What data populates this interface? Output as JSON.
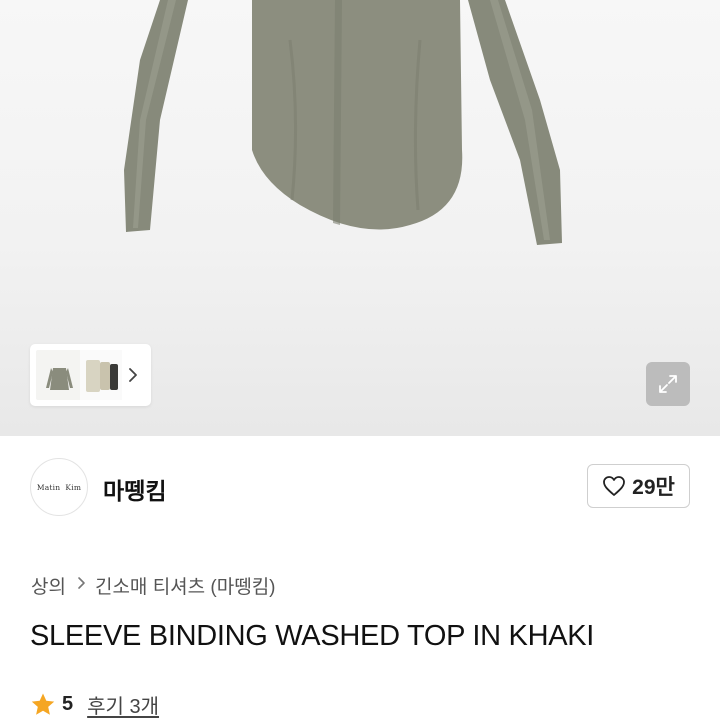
{
  "gallery": {
    "thumbnail_next_icon": "chevron-right-icon",
    "expand_icon": "expand-arrows-icon"
  },
  "seller": {
    "logo_text": "Matin  Kim",
    "name": "마뗑킴",
    "like_icon": "heart-outline-icon",
    "like_count": "29만"
  },
  "product": {
    "breadcrumb": [
      "상의",
      "긴소매 티셔츠 (마뗑킴)"
    ],
    "title": "SLEEVE BINDING WASHED TOP IN KHAKI"
  },
  "rating": {
    "star_icon": "star-icon",
    "star_color": "#F5A623",
    "score": "5",
    "reviews_label": "후기 3개"
  },
  "colors": {
    "garment": "#8a8c7d",
    "accent_text": "#111111"
  }
}
